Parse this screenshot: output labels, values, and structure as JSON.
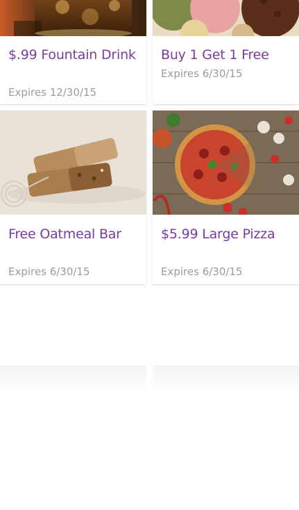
{
  "deals": [
    {
      "title": "$.99 Fountain Drink",
      "expires": "Expires 12/30/15",
      "image": "soda-glass-image"
    },
    {
      "title": "Buy 1 Get 1 Free",
      "expires": "Expires 6/30/15",
      "image": "ice-cream-scoops-image"
    },
    {
      "title": "Free Oatmeal Bar",
      "expires": "Expires 6/30/15",
      "image": "oatmeal-bars-image"
    },
    {
      "title": "$5.99 Large Pizza",
      "expires": "Expires 6/30/15",
      "image": "pizza-image"
    }
  ],
  "colors": {
    "title": "#7a3a9e",
    "expires": "#9b9b9b",
    "card_bg": "#ffffff"
  }
}
